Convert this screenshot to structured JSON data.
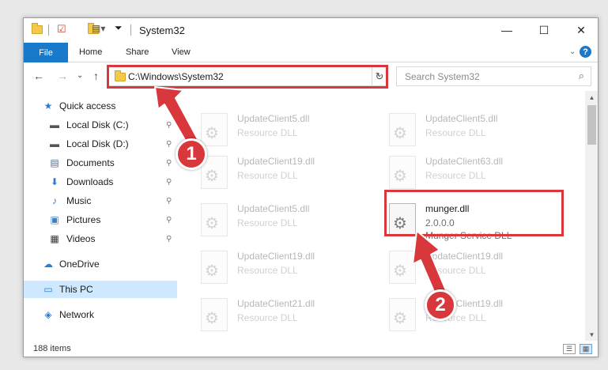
{
  "window": {
    "title": "System32"
  },
  "window_controls": {
    "minimize": "—",
    "maximize": "☐",
    "close": "✕"
  },
  "ribbon": {
    "file": "File",
    "tabs": [
      "Home",
      "Share",
      "View"
    ],
    "expand": "⌄",
    "help": "?"
  },
  "navigation": {
    "back": "←",
    "forward": "→",
    "recent": "⌄",
    "up": "↑"
  },
  "address": {
    "path": "C:\\Windows\\System32",
    "dropdown": "⌄",
    "refresh": "↻"
  },
  "search": {
    "placeholder": "Search System32",
    "icon": "⌕"
  },
  "sidebar": {
    "items": [
      {
        "label": "Quick access",
        "icon": "★",
        "pinned": false
      },
      {
        "label": "Local Disk (C:)",
        "icon": "▬",
        "pinned": true
      },
      {
        "label": "Local Disk (D:)",
        "icon": "▬",
        "pinned": true
      },
      {
        "label": "Documents",
        "icon": "▤",
        "pinned": true
      },
      {
        "label": "Downloads",
        "icon": "⬇",
        "pinned": true
      },
      {
        "label": "Music",
        "icon": "♪",
        "pinned": true
      },
      {
        "label": "Pictures",
        "icon": "▣",
        "pinned": true
      },
      {
        "label": "Videos",
        "icon": "▦",
        "pinned": true
      },
      {
        "label": "OneDrive",
        "icon": "☁",
        "pinned": false
      },
      {
        "label": "This PC",
        "icon": "▭",
        "pinned": false,
        "selected": true
      },
      {
        "label": "Network",
        "icon": "◈",
        "pinned": false
      }
    ],
    "pin_icon": "📌"
  },
  "files": [
    {
      "name": "UpdateClient5.dll",
      "line1": "Resource DLL",
      "line2": ""
    },
    {
      "name": "UpdateClient5.dll",
      "line1": "Resource DLL",
      "line2": ""
    },
    {
      "name": "UpdateClient19.dll",
      "line1": "Resource DLL",
      "line2": ""
    },
    {
      "name": "UpdateClient63.dll",
      "line1": "Resource DLL",
      "line2": ""
    },
    {
      "name": "UpdateClient5.dll",
      "line1": "Resource DLL",
      "line2": ""
    },
    {
      "name": "munger.dll",
      "line1": "2.0.0.0",
      "line2": "Munger Service DLL"
    },
    {
      "name": "UpdateClient19.dll",
      "line1": "Resource DLL",
      "line2": ""
    },
    {
      "name": "UpdateClient19.dll",
      "line1": "Resource DLL",
      "line2": ""
    },
    {
      "name": "UpdateClient21.dll",
      "line1": "Resource DLL",
      "line2": ""
    },
    {
      "name": "UpdateClient19.dll",
      "line1": "Resource DLL",
      "line2": ""
    }
  ],
  "status": {
    "item_count": "188 items"
  },
  "annotations": [
    {
      "label": "1"
    },
    {
      "label": "2"
    }
  ],
  "colors": {
    "accent": "#1979ca",
    "annotation": "#d8373b",
    "selection": "#cde8ff"
  }
}
